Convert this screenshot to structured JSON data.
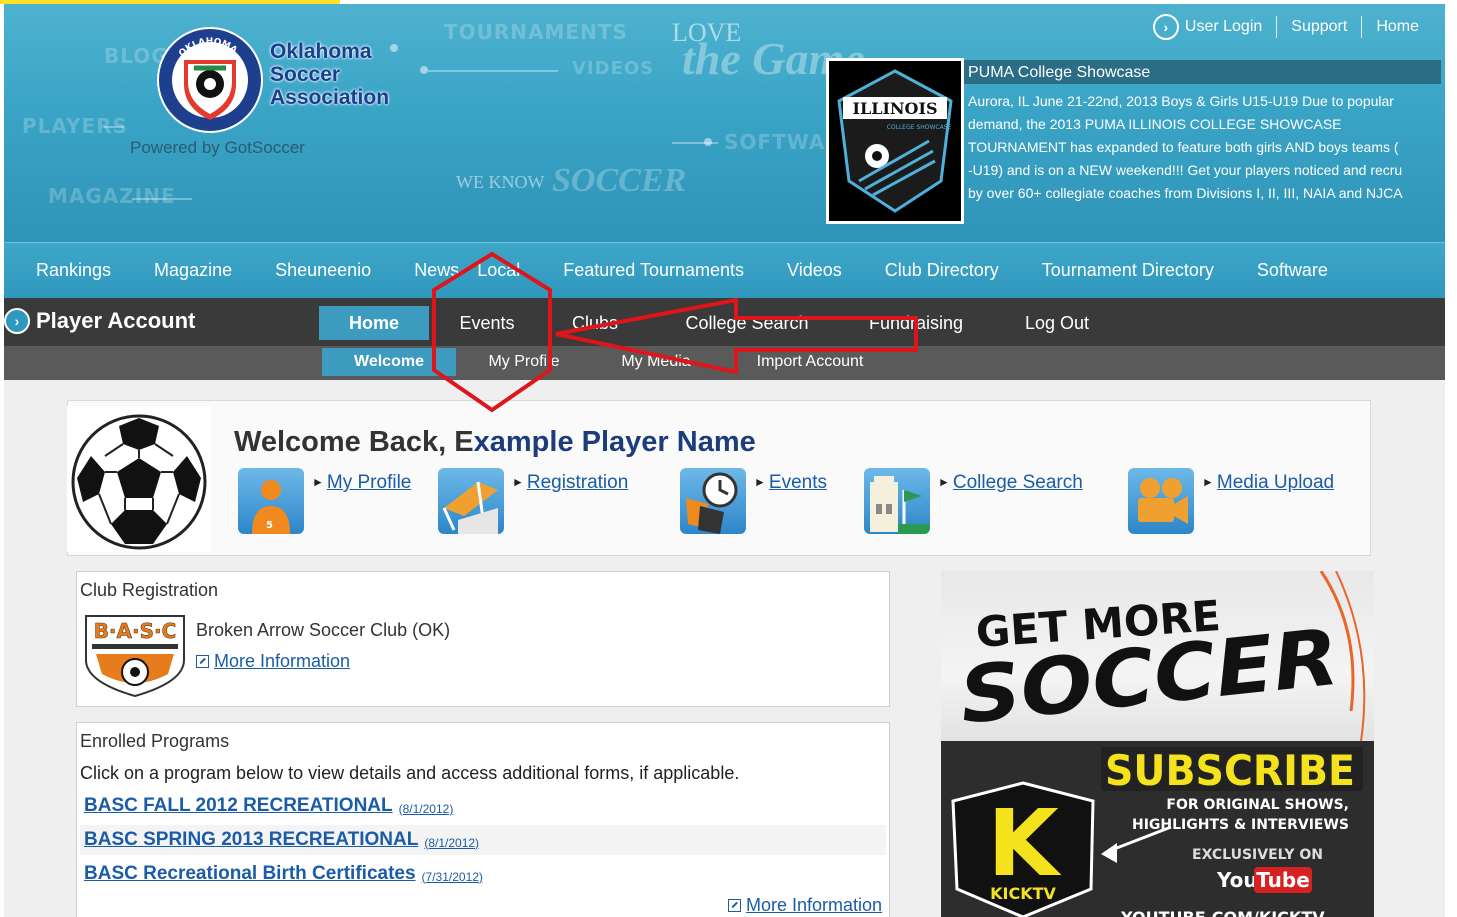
{
  "header": {
    "brand_line1": "Oklahoma",
    "brand_line2": "Soccer",
    "brand_line3": "Association",
    "logo_text": "OKLAHOMA",
    "powered_by": "Powered by GotSoccer",
    "bg_words": {
      "blog": "BLOG",
      "tournaments": "TOURNAMENTS",
      "videos": "VIDEOS",
      "players": "PLAYERS",
      "software": "SOFTWARE",
      "magazine": "MAGAZINE",
      "love": "LOVE",
      "game": "the Game",
      "we_know": "WE KNOW",
      "soccer": "SOCCER"
    }
  },
  "top_links": {
    "login": "User Login",
    "support": "Support",
    "home": "Home"
  },
  "feature": {
    "title": "PUMA College Showcase",
    "lines": [
      "Aurora, IL June 21-22nd, 2013 Boys & Girls U15-U19 Due to popular",
      "demand, the 2013 PUMA ILLINOIS COLLEGE SHOWCASE",
      "TOURNAMENT has expanded to feature both girls AND boys teams (",
      "-U19) and is on a NEW weekend!!! Get your players noticed and recru",
      "by over 60+ collegiate coaches from Divisions I, II, III, NAIA and NJCA"
    ],
    "image_text": "ILLINOIS",
    "image_subtext": "COLLEGE SHOWCASE"
  },
  "main_nav": [
    "Rankings",
    "Magazine",
    "Sheuneenio",
    "News",
    "Local",
    "Featured Tournaments",
    "Videos",
    "Club Directory",
    "Tournament Directory",
    "Software"
  ],
  "account_nav": {
    "title": "Player Account",
    "tabs": [
      "Home",
      "Events",
      "Clubs",
      "College Search",
      "Fundraising",
      "Log Out"
    ],
    "subtabs": [
      "Welcome",
      "My Profile",
      "My Media",
      "Import Account"
    ]
  },
  "welcome": {
    "prefix": "Welcome Back, E",
    "name": "xample Player Name",
    "links": [
      "My Profile",
      "Registration",
      "Events",
      "College Search",
      "Media Upload"
    ]
  },
  "club_registration": {
    "title": "Club Registration",
    "club_name": "Broken Arrow Soccer Club (OK)",
    "logo_text": "B·A·S·C",
    "more_info": "More Information"
  },
  "programs": {
    "title": "Enrolled Programs",
    "intro": "Click on a program below to view details and access additional forms, if applicable.",
    "items": [
      {
        "name": "BASC FALL 2012 RECREATIONAL",
        "date": "(8/1/2012)"
      },
      {
        "name": "BASC SPRING 2013 RECREATIONAL",
        "date": "(8/1/2012)"
      },
      {
        "name": "BASC Recreational Birth Certificates",
        "date": "(7/31/2012)"
      }
    ],
    "more_info": "More Information"
  },
  "ad": {
    "line1": "GET MORE",
    "line2": "SOCCER",
    "subscribe": "SUBSCRIBE",
    "tagline1": "FOR ORIGINAL SHOWS,",
    "tagline2": "HIGHLIGHTS & INTERVIEWS",
    "exclusive": "EXCLUSIVELY ON",
    "you": "You",
    "tube": "Tube",
    "kick_letter": "K",
    "kick_name": "KICKTV",
    "url": "YOUTUBE.COM/KICKTV"
  },
  "colors": {
    "header_blue": "#3aa4c6",
    "nav_blue": "#2f98bd",
    "account_dark": "#3a3a3a",
    "link_blue": "#1a5ca8",
    "annotation_red": "#e0141b"
  }
}
